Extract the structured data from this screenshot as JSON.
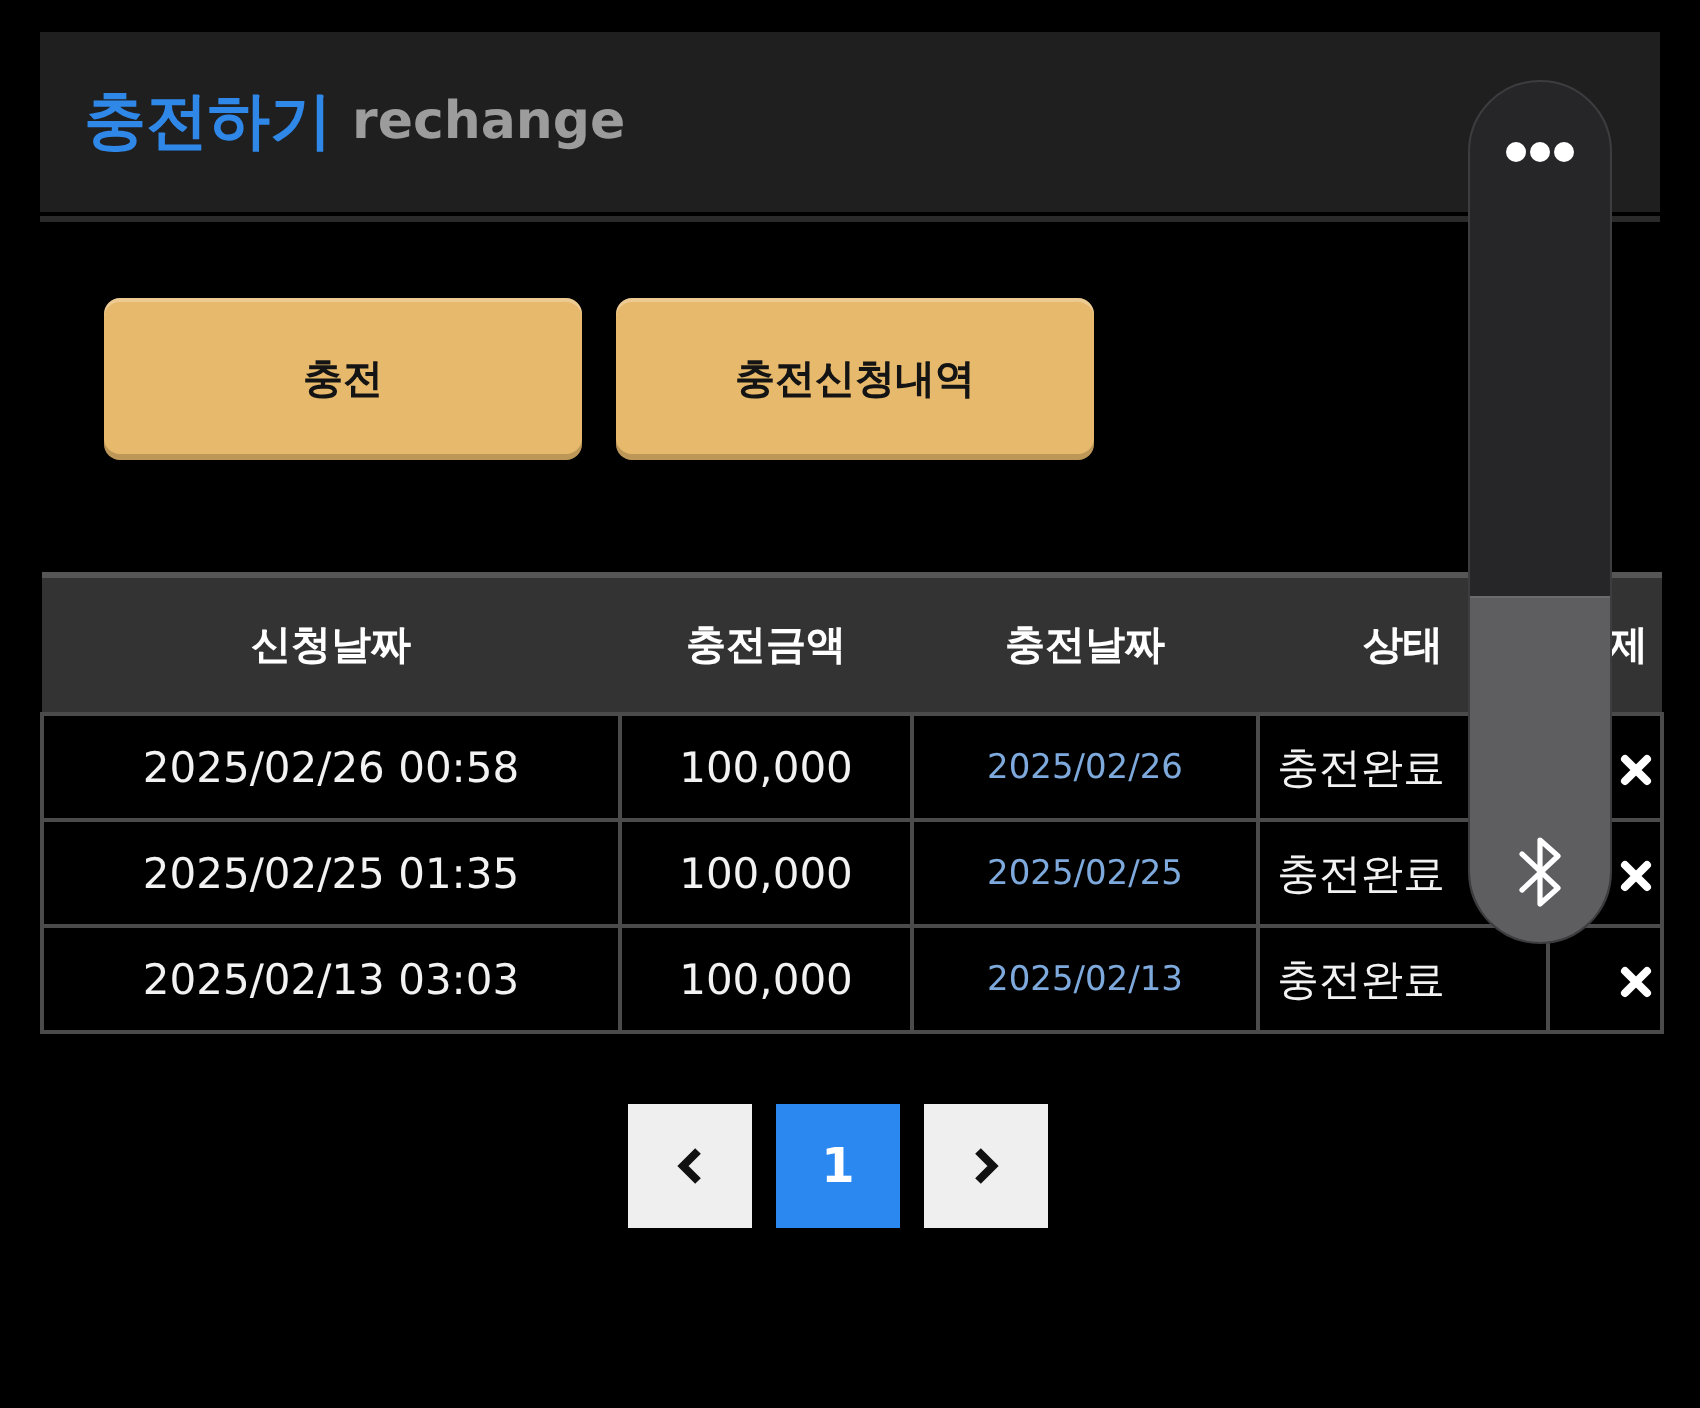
{
  "header": {
    "title": "충전하기",
    "subtitle": "rechange"
  },
  "actions": [
    {
      "label": "충전"
    },
    {
      "label": "충전신청내역"
    }
  ],
  "table": {
    "columns": [
      "신청날짜",
      "충전금액",
      "충전날짜",
      "상태",
      "제"
    ],
    "rows": [
      {
        "requested_at": "2025/02/26 00:58",
        "amount": "100,000",
        "charged_on": "2025/02/26",
        "status": "충전완료"
      },
      {
        "requested_at": "2025/02/25 01:35",
        "amount": "100,000",
        "charged_on": "2025/02/25",
        "status": "충전완료"
      },
      {
        "requested_at": "2025/02/13 03:03",
        "amount": "100,000",
        "charged_on": "2025/02/13",
        "status": "충전완료"
      }
    ]
  },
  "pagination": {
    "pages": [
      {
        "label": "1",
        "selected": true
      }
    ]
  },
  "volume_panel": {
    "level": 0.4
  }
}
